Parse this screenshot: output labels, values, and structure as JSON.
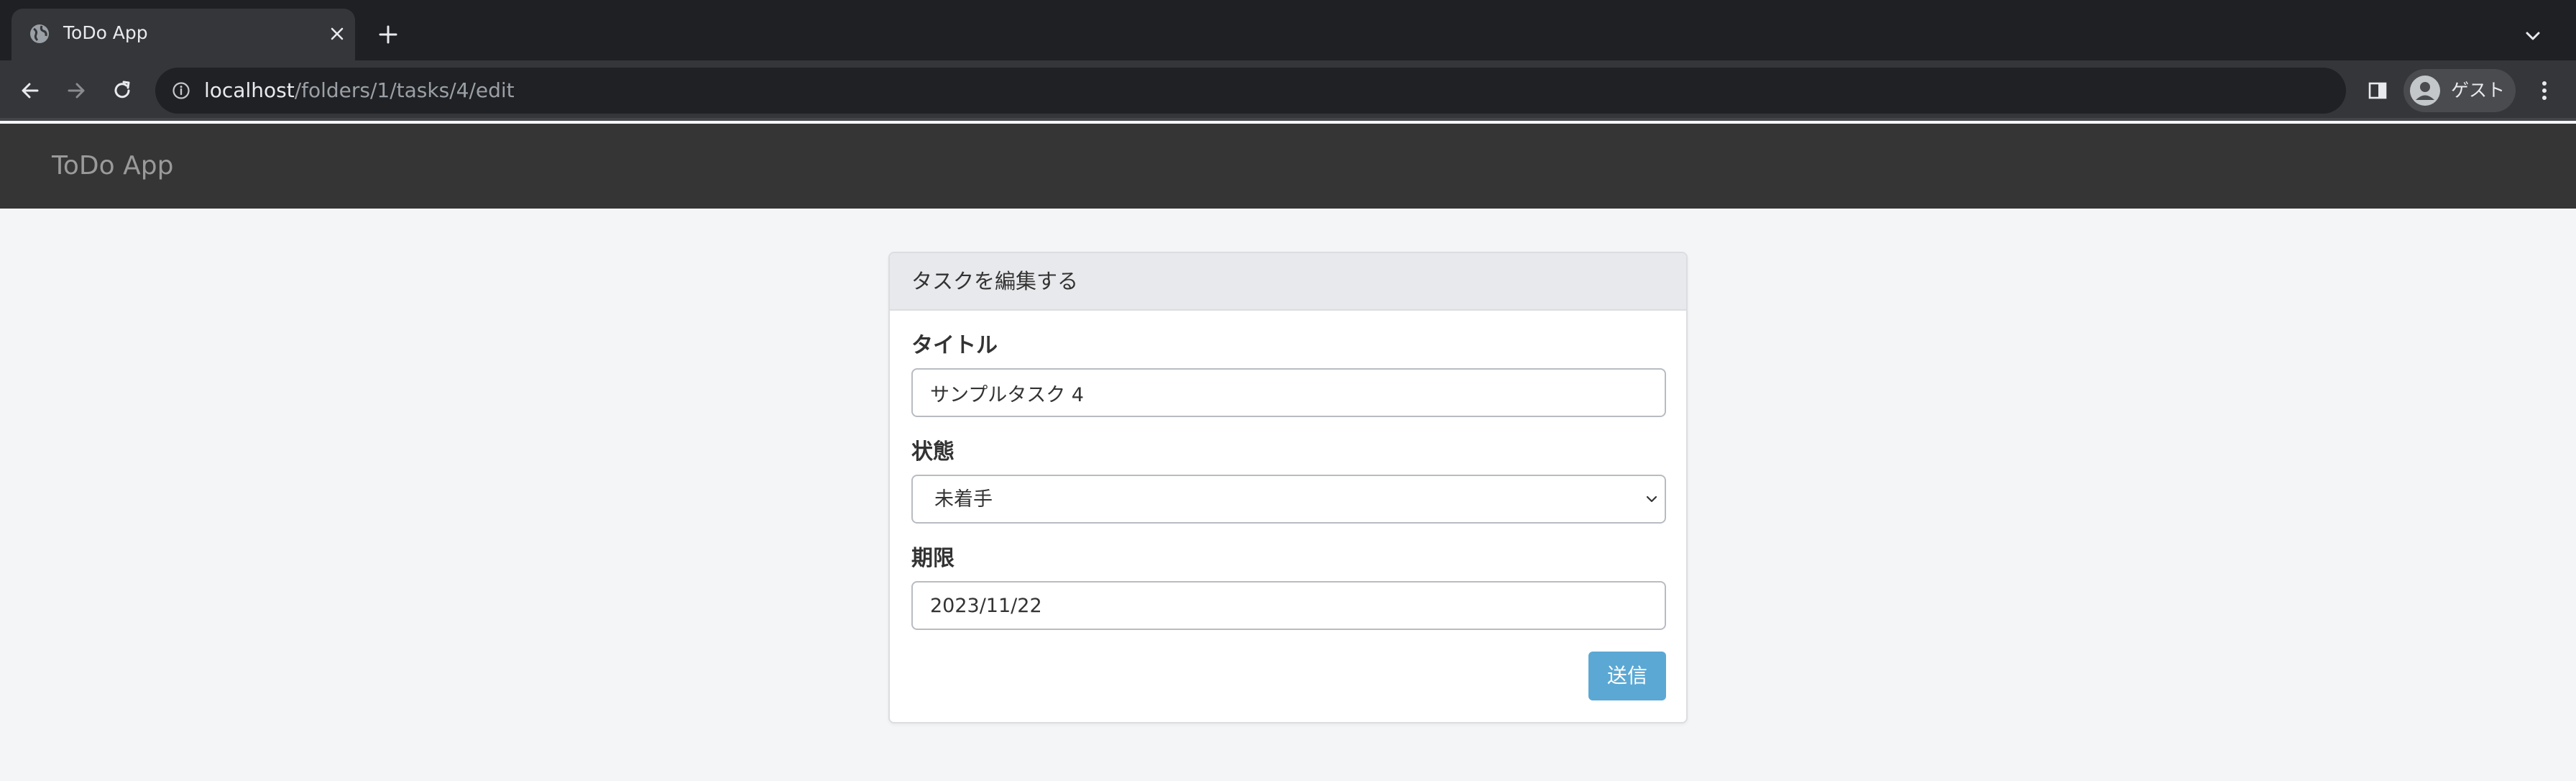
{
  "browser": {
    "tab": {
      "title": "ToDo App",
      "favicon": "globe-icon"
    },
    "address_bar": {
      "host": "localhost",
      "path": "/folders/1/tasks/4/edit"
    },
    "profile": {
      "name": "ゲスト"
    }
  },
  "navbar": {
    "brand": "ToDo App"
  },
  "form": {
    "header": "タスクを編集する",
    "title_label": "タイトル",
    "title_value": "サンプルタスク 4",
    "status_label": "状態",
    "status_value": "未着手",
    "due_label": "期限",
    "due_value": "2023/11/22",
    "submit_label": "送信"
  },
  "colors": {
    "navbar_bg": "#353535",
    "submit_bg": "#5ba8d4",
    "page_bg": "#f4f5f7"
  }
}
